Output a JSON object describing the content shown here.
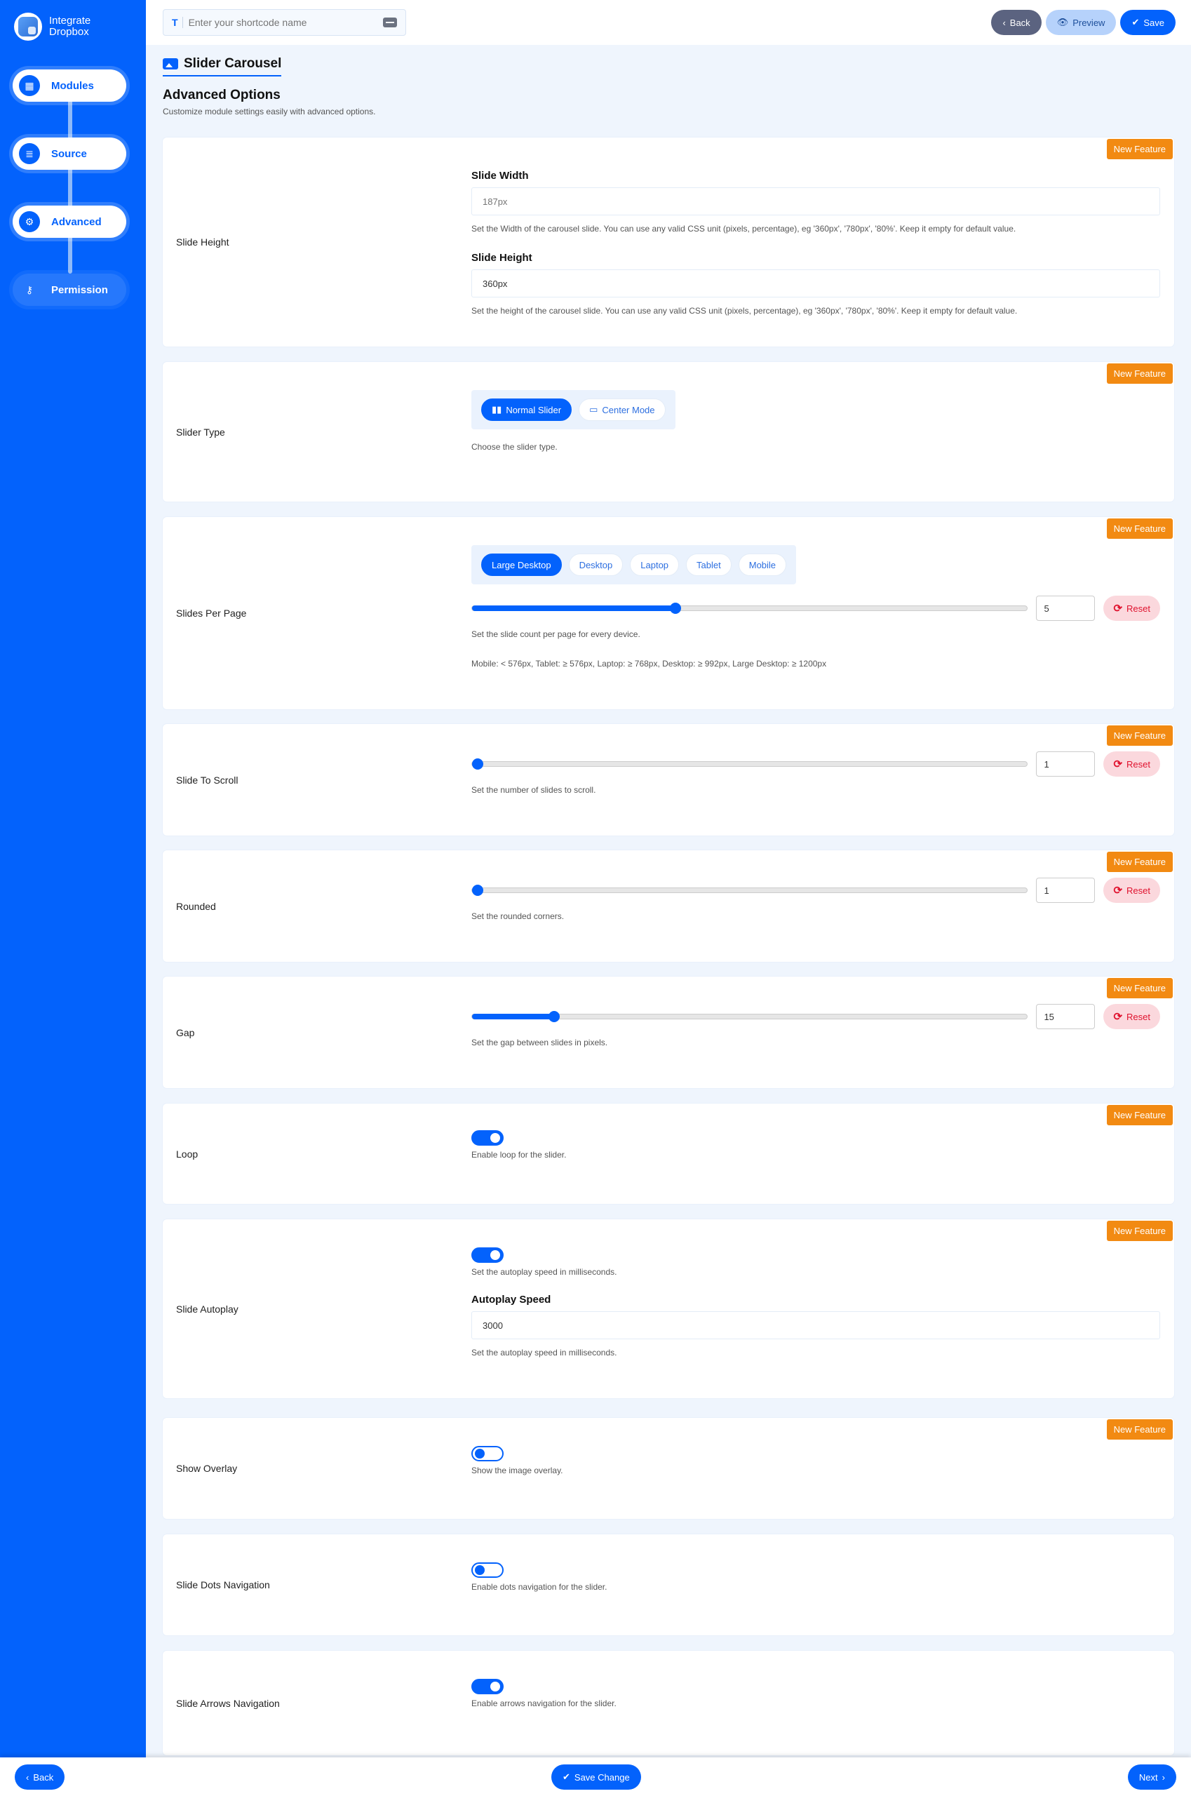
{
  "brand": {
    "name_line1": "Integrate",
    "name_line2": "Dropbox"
  },
  "sidebar": {
    "items": [
      {
        "label": "Modules",
        "icon": "grid-icon",
        "state": "complete"
      },
      {
        "label": "Source",
        "icon": "database-icon",
        "state": "complete"
      },
      {
        "label": "Advanced",
        "icon": "gears-icon",
        "state": "active"
      },
      {
        "label": "Permission",
        "icon": "user-key-icon",
        "state": "pending"
      }
    ]
  },
  "topbar": {
    "shortcode_placeholder": "Enter your shortcode name",
    "shortcode_value": "",
    "back_label": "Back",
    "preview_label": "Preview",
    "save_label": "Save"
  },
  "header": {
    "module_title": "Slider Carousel",
    "section_title": "Advanced Options",
    "section_subtitle": "Customize module settings easily with advanced options."
  },
  "badge_label": "New Feature",
  "reset_label": "Reset",
  "settings": {
    "slide_height": {
      "label": "Slide Height",
      "width_label": "Slide Width",
      "width_placeholder": "187px",
      "width_desc": "Set the Width of the carousel slide. You can use any valid CSS unit (pixels, percentage), eg '360px', '780px', '80%'. Keep it empty for default value.",
      "height_label": "Slide Height",
      "height_value": "360px",
      "height_desc": "Set the height of the carousel slide. You can use any valid CSS unit (pixels, percentage), eg '360px', '780px', '80%'. Keep it empty for default value."
    },
    "slider_type": {
      "label": "Slider Type",
      "options": [
        "Normal Slider",
        "Center Mode"
      ],
      "selected": "Normal Slider",
      "desc": "Choose the slider type."
    },
    "slides_per_page": {
      "label": "Slides Per Page",
      "devices": [
        "Large Desktop",
        "Desktop",
        "Laptop",
        "Tablet",
        "Mobile"
      ],
      "selected_device": "Large Desktop",
      "value": "5",
      "slider_fraction": 0.367,
      "desc": "Set the slide count per page for every device.",
      "breakpoints": "Mobile: < 576px, Tablet: ≥ 576px, Laptop: ≥ 768px, Desktop: ≥ 992px, Large Desktop: ≥ 1200px"
    },
    "slide_to_scroll": {
      "label": "Slide To Scroll",
      "value": "1",
      "slider_fraction": 0.0,
      "desc": "Set the number of slides to scroll."
    },
    "rounded": {
      "label": "Rounded",
      "value": "1",
      "slider_fraction": 0.0,
      "desc": "Set the rounded corners."
    },
    "gap": {
      "label": "Gap",
      "value": "15",
      "slider_fraction": 0.148,
      "desc": "Set the gap between slides in pixels."
    },
    "loop": {
      "label": "Loop",
      "enabled": true,
      "desc": "Enable loop for the slider."
    },
    "autoplay": {
      "label": "Slide Autoplay",
      "enabled": true,
      "desc": "Set the autoplay speed in milliseconds.",
      "speed_label": "Autoplay Speed",
      "speed_value": "3000",
      "speed_desc": "Set the autoplay speed in milliseconds."
    },
    "overlay": {
      "label": "Show Overlay",
      "enabled": false,
      "desc": "Show the image overlay."
    },
    "dots": {
      "label": "Slide Dots Navigation",
      "enabled": false,
      "desc": "Enable dots navigation for the slider."
    },
    "arrows": {
      "label": "Slide Arrows Navigation",
      "enabled": true,
      "desc": "Enable arrows navigation for the slider."
    }
  },
  "footer": {
    "back_label": "Back",
    "save_change_label": "Save Change",
    "next_label": "Next"
  },
  "colors": {
    "primary": "#0362fc",
    "badge": "#f28a12",
    "reset_bg": "#fbd8dd",
    "reset_text": "#e0122e",
    "back_btn": "#5b6380",
    "preview_btn": "#b6d2fb"
  }
}
